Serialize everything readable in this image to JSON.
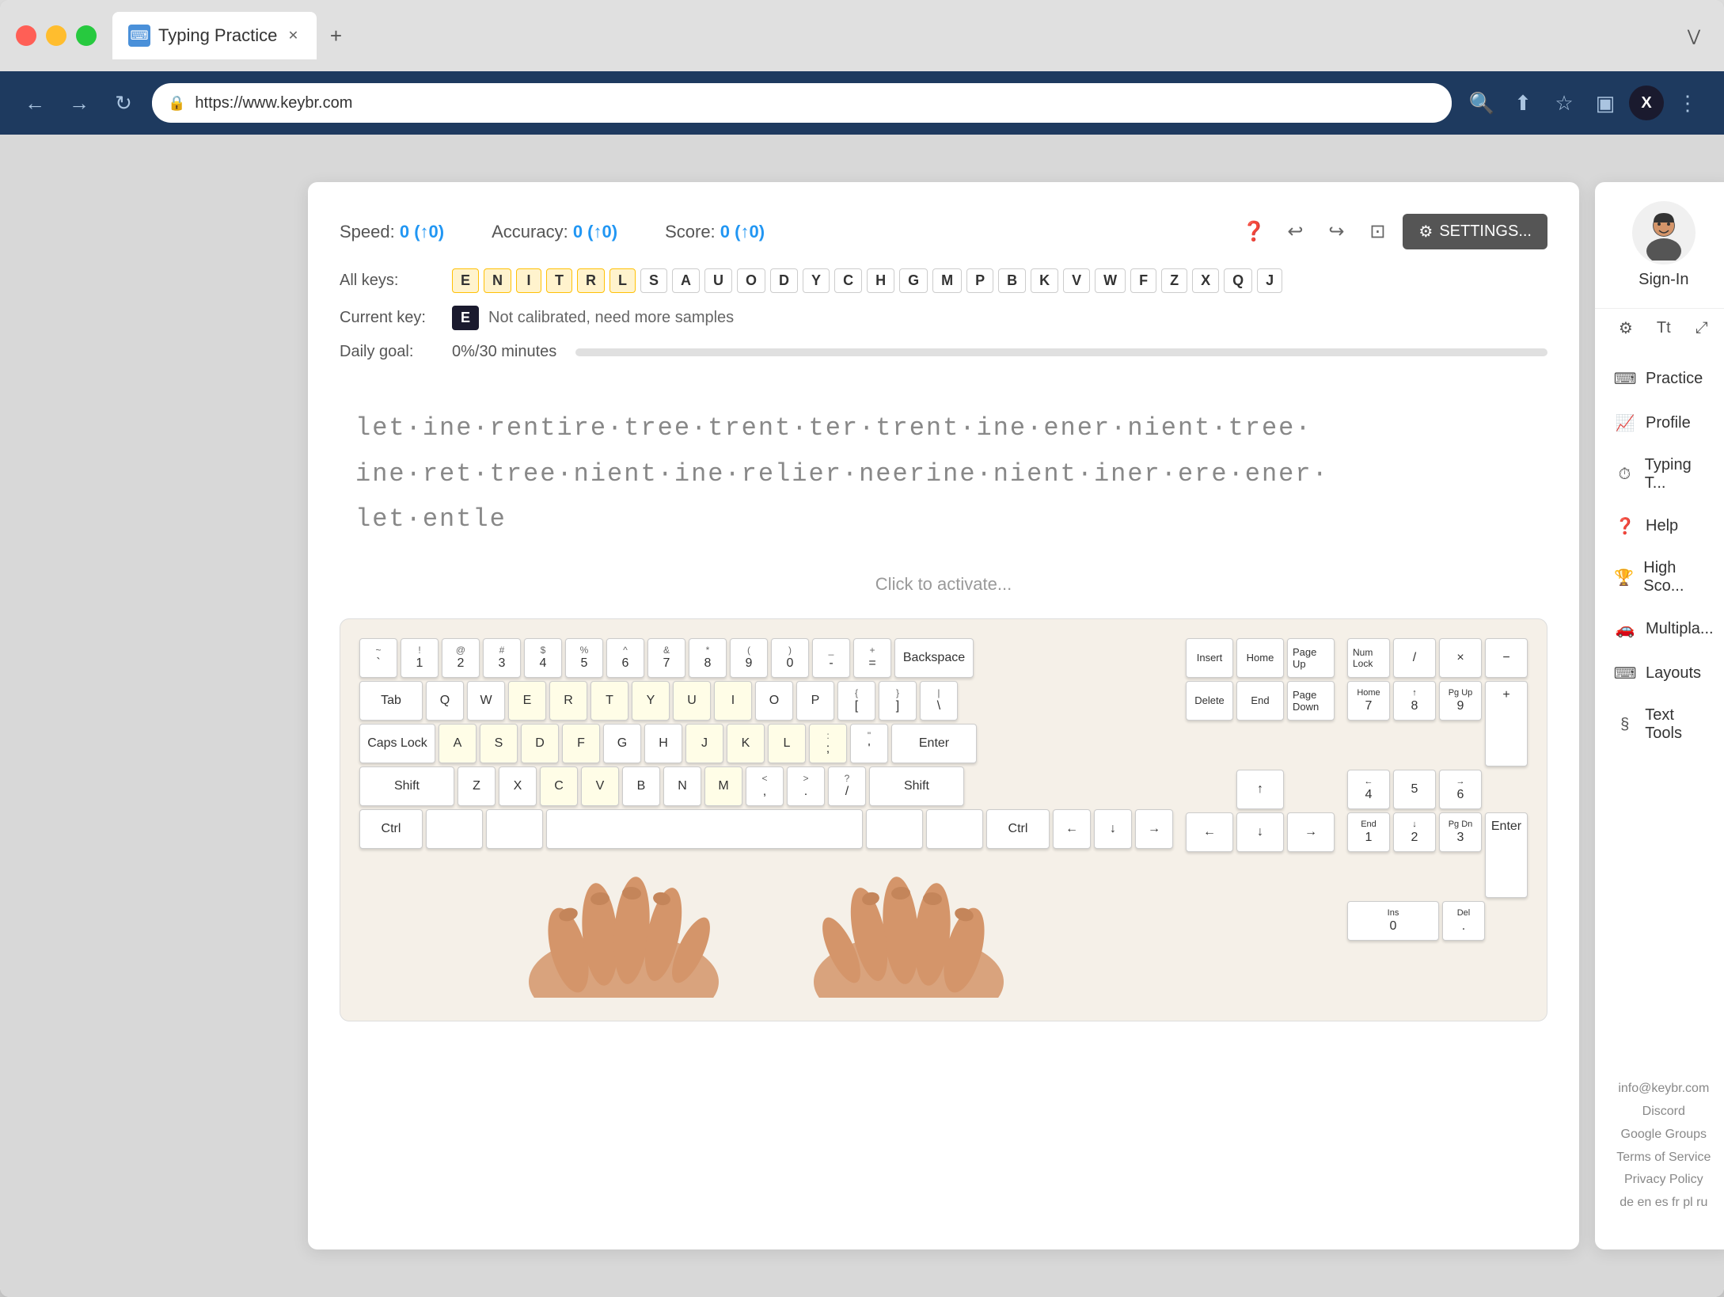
{
  "browser": {
    "tab_title": "Typing Practice",
    "tab_favicon": "⌨",
    "url": "https://www.keybr.com",
    "new_tab_label": "+",
    "window_menu_label": "⋮"
  },
  "nav": {
    "back_label": "←",
    "forward_label": "→",
    "refresh_label": "↻"
  },
  "toolbar": {
    "search_label": "🔍",
    "share_label": "⬆",
    "bookmark_label": "☆",
    "split_label": "⊡",
    "profile_label": "X",
    "more_label": "⋮"
  },
  "stats": {
    "speed_label": "Speed:",
    "speed_value": "0 (↑0)",
    "accuracy_label": "Accuracy:",
    "accuracy_value": "0 (↑0)",
    "score_label": "Score:",
    "score_value": "0 (↑0)",
    "settings_label": "SETTINGS..."
  },
  "keys": {
    "all_keys_label": "All keys:",
    "current_key_label": "Current key:",
    "daily_goal_label": "Daily goal:",
    "daily_goal_value": "0%/30 minutes",
    "calibration_msg": "Not calibrated, need more samples",
    "current_key": "E",
    "key_list": [
      "E",
      "N",
      "I",
      "T",
      "R",
      "L",
      "S",
      "A",
      "U",
      "O",
      "D",
      "Y",
      "C",
      "H",
      "G",
      "M",
      "P",
      "B",
      "K",
      "V",
      "W",
      "F",
      "Z",
      "X",
      "Q",
      "J"
    ]
  },
  "typing_text": {
    "line1": "let·ine·rentire·tree·trent·ter·trent·ine·ener·nient·tree·",
    "line2": "ine·ret·tree·nient·ine·relier·neerine·nient·iner·ere·ener·",
    "line3": "let·entle",
    "click_prompt": "Click to activate..."
  },
  "keyboard": {
    "rows": {
      "num_row": [
        "`",
        "1",
        "2",
        "3",
        "4",
        "5",
        "6",
        "7",
        "8",
        "9",
        "0",
        "-",
        "="
      ],
      "top_row": [
        "Q",
        "W",
        "E",
        "R",
        "T",
        "Y",
        "U",
        "I",
        "O",
        "P",
        "[",
        "]",
        "\\"
      ],
      "home_row": [
        "A",
        "S",
        "D",
        "F",
        "G",
        "H",
        "J",
        "K",
        "L",
        ";",
        "'"
      ],
      "bottom_row": [
        "Z",
        "X",
        "C",
        "V",
        "B",
        "N",
        "M",
        ",",
        ".",
        "/"
      ],
      "special_keys": {
        "backspace": "Backspace",
        "tab": "Tab",
        "caps_lock": "Caps Lock",
        "enter": "Enter",
        "shift_l": "Shift",
        "shift_r": "Shift",
        "ctrl_l": "Ctrl",
        "ctrl_r": "Ctrl",
        "space": "",
        "delete": "Delete",
        "insert": "Insert",
        "home": "Home",
        "end": "End",
        "page_up": "Page Up",
        "page_down": "Page Down",
        "num_lock": "Num Lock"
      }
    }
  },
  "sidebar": {
    "signin_label": "Sign-In",
    "nav_items": [
      {
        "label": "Practice",
        "icon": "⌨"
      },
      {
        "label": "Profile",
        "icon": "📈"
      },
      {
        "label": "Typing T...",
        "icon": "⏱"
      },
      {
        "label": "Help",
        "icon": "❓"
      },
      {
        "label": "High Sco...",
        "icon": "🏆"
      },
      {
        "label": "Multipla...",
        "icon": "🚗"
      },
      {
        "label": "Layouts",
        "icon": "⌨"
      },
      {
        "label": "Text Tools",
        "icon": "§"
      }
    ],
    "footer": {
      "email": "info@keybr.com",
      "discord": "Discord",
      "google_groups": "Google Groups",
      "terms": "Terms of Service",
      "privacy": "Privacy Policy",
      "languages": "de en es fr pl ru"
    }
  }
}
